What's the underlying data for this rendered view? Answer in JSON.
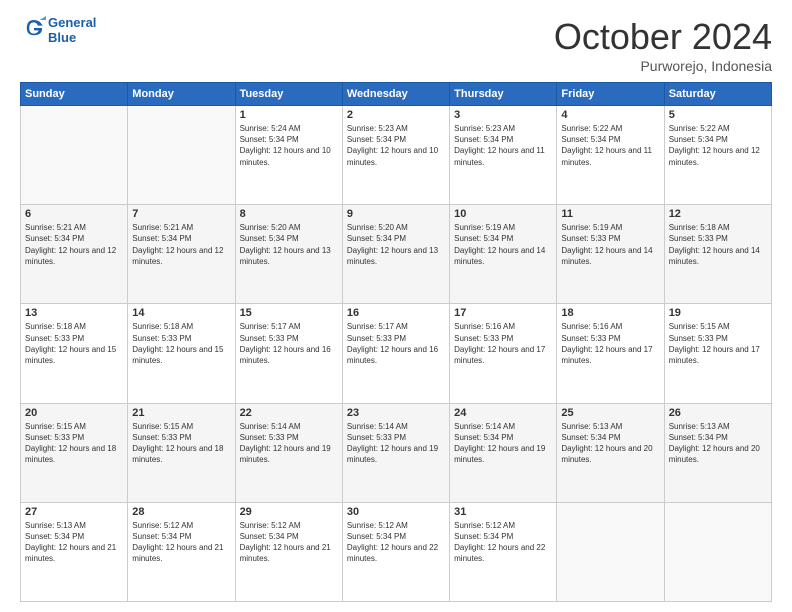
{
  "header": {
    "logo_line1": "General",
    "logo_line2": "Blue",
    "month": "October 2024",
    "location": "Purworejo, Indonesia"
  },
  "weekdays": [
    "Sunday",
    "Monday",
    "Tuesday",
    "Wednesday",
    "Thursday",
    "Friday",
    "Saturday"
  ],
  "weeks": [
    [
      {
        "day": "",
        "info": ""
      },
      {
        "day": "",
        "info": ""
      },
      {
        "day": "1",
        "info": "Sunrise: 5:24 AM\nSunset: 5:34 PM\nDaylight: 12 hours and 10 minutes."
      },
      {
        "day": "2",
        "info": "Sunrise: 5:23 AM\nSunset: 5:34 PM\nDaylight: 12 hours and 10 minutes."
      },
      {
        "day": "3",
        "info": "Sunrise: 5:23 AM\nSunset: 5:34 PM\nDaylight: 12 hours and 11 minutes."
      },
      {
        "day": "4",
        "info": "Sunrise: 5:22 AM\nSunset: 5:34 PM\nDaylight: 12 hours and 11 minutes."
      },
      {
        "day": "5",
        "info": "Sunrise: 5:22 AM\nSunset: 5:34 PM\nDaylight: 12 hours and 12 minutes."
      }
    ],
    [
      {
        "day": "6",
        "info": "Sunrise: 5:21 AM\nSunset: 5:34 PM\nDaylight: 12 hours and 12 minutes."
      },
      {
        "day": "7",
        "info": "Sunrise: 5:21 AM\nSunset: 5:34 PM\nDaylight: 12 hours and 12 minutes."
      },
      {
        "day": "8",
        "info": "Sunrise: 5:20 AM\nSunset: 5:34 PM\nDaylight: 12 hours and 13 minutes."
      },
      {
        "day": "9",
        "info": "Sunrise: 5:20 AM\nSunset: 5:34 PM\nDaylight: 12 hours and 13 minutes."
      },
      {
        "day": "10",
        "info": "Sunrise: 5:19 AM\nSunset: 5:34 PM\nDaylight: 12 hours and 14 minutes."
      },
      {
        "day": "11",
        "info": "Sunrise: 5:19 AM\nSunset: 5:33 PM\nDaylight: 12 hours and 14 minutes."
      },
      {
        "day": "12",
        "info": "Sunrise: 5:18 AM\nSunset: 5:33 PM\nDaylight: 12 hours and 14 minutes."
      }
    ],
    [
      {
        "day": "13",
        "info": "Sunrise: 5:18 AM\nSunset: 5:33 PM\nDaylight: 12 hours and 15 minutes."
      },
      {
        "day": "14",
        "info": "Sunrise: 5:18 AM\nSunset: 5:33 PM\nDaylight: 12 hours and 15 minutes."
      },
      {
        "day": "15",
        "info": "Sunrise: 5:17 AM\nSunset: 5:33 PM\nDaylight: 12 hours and 16 minutes."
      },
      {
        "day": "16",
        "info": "Sunrise: 5:17 AM\nSunset: 5:33 PM\nDaylight: 12 hours and 16 minutes."
      },
      {
        "day": "17",
        "info": "Sunrise: 5:16 AM\nSunset: 5:33 PM\nDaylight: 12 hours and 17 minutes."
      },
      {
        "day": "18",
        "info": "Sunrise: 5:16 AM\nSunset: 5:33 PM\nDaylight: 12 hours and 17 minutes."
      },
      {
        "day": "19",
        "info": "Sunrise: 5:15 AM\nSunset: 5:33 PM\nDaylight: 12 hours and 17 minutes."
      }
    ],
    [
      {
        "day": "20",
        "info": "Sunrise: 5:15 AM\nSunset: 5:33 PM\nDaylight: 12 hours and 18 minutes."
      },
      {
        "day": "21",
        "info": "Sunrise: 5:15 AM\nSunset: 5:33 PM\nDaylight: 12 hours and 18 minutes."
      },
      {
        "day": "22",
        "info": "Sunrise: 5:14 AM\nSunset: 5:33 PM\nDaylight: 12 hours and 19 minutes."
      },
      {
        "day": "23",
        "info": "Sunrise: 5:14 AM\nSunset: 5:33 PM\nDaylight: 12 hours and 19 minutes."
      },
      {
        "day": "24",
        "info": "Sunrise: 5:14 AM\nSunset: 5:34 PM\nDaylight: 12 hours and 19 minutes."
      },
      {
        "day": "25",
        "info": "Sunrise: 5:13 AM\nSunset: 5:34 PM\nDaylight: 12 hours and 20 minutes."
      },
      {
        "day": "26",
        "info": "Sunrise: 5:13 AM\nSunset: 5:34 PM\nDaylight: 12 hours and 20 minutes."
      }
    ],
    [
      {
        "day": "27",
        "info": "Sunrise: 5:13 AM\nSunset: 5:34 PM\nDaylight: 12 hours and 21 minutes."
      },
      {
        "day": "28",
        "info": "Sunrise: 5:12 AM\nSunset: 5:34 PM\nDaylight: 12 hours and 21 minutes."
      },
      {
        "day": "29",
        "info": "Sunrise: 5:12 AM\nSunset: 5:34 PM\nDaylight: 12 hours and 21 minutes."
      },
      {
        "day": "30",
        "info": "Sunrise: 5:12 AM\nSunset: 5:34 PM\nDaylight: 12 hours and 22 minutes."
      },
      {
        "day": "31",
        "info": "Sunrise: 5:12 AM\nSunset: 5:34 PM\nDaylight: 12 hours and 22 minutes."
      },
      {
        "day": "",
        "info": ""
      },
      {
        "day": "",
        "info": ""
      }
    ]
  ]
}
